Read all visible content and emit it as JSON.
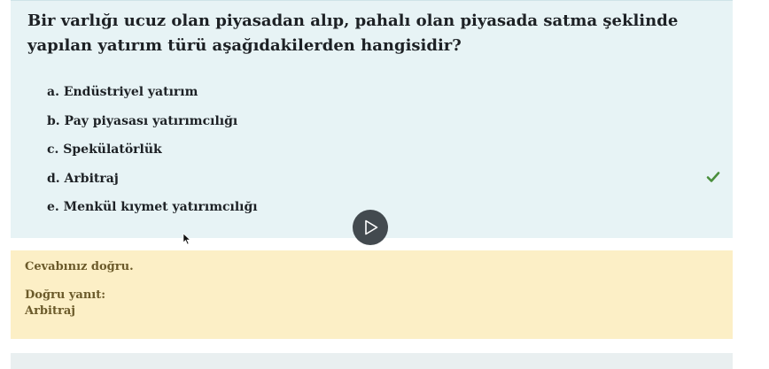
{
  "question": {
    "text": "Bir varlığı ucuz olan piyasadan alıp, pahalı olan piyasada satma şeklinde yapılan yatırım türü aşağıdakilerden hangisidir?",
    "answers": [
      {
        "label": "a. Endüstriyel yatırım",
        "correct": false
      },
      {
        "label": "b. Pay piyasası yatırımcılığı",
        "correct": false
      },
      {
        "label": "c. Spekülatörlük",
        "correct": false
      },
      {
        "label": "d. Arbitraj",
        "correct": true
      },
      {
        "label": "e. Menkül kıymet yatırımcılığı",
        "correct": false
      }
    ],
    "correct_icon": "check-icon",
    "check_color": "#4a8f3c"
  },
  "media": {
    "play_icon": "play-icon"
  },
  "feedback": {
    "status": "Cevabınız doğru.",
    "right_answer_label": "Doğru yanıt:",
    "right_answer_value": "Arbitraj"
  },
  "colors": {
    "question_bg": "#e7f3f5",
    "feedback_bg": "#fcefc6"
  }
}
